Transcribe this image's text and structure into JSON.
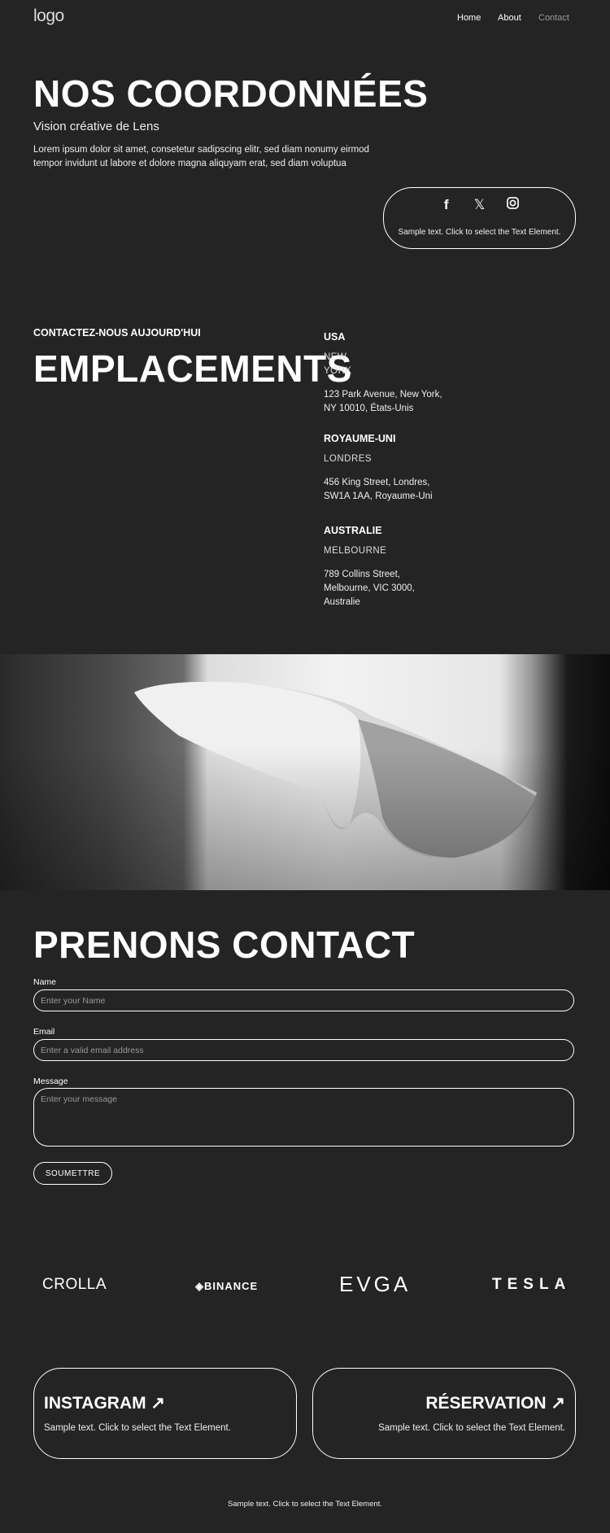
{
  "header": {
    "logo": "logo",
    "nav": [
      {
        "label": "Home"
      },
      {
        "label": "About"
      },
      {
        "label": "Contact"
      }
    ],
    "nav_active_color": "#9a9a9a"
  },
  "hero": {
    "title": "NOS COORDONNÉES",
    "subtitle": "Vision créative de Lens",
    "body": "Lorem ipsum dolor sit amet, consetetur sadipscing elitr, sed diam nonumy eirmod tempor invidunt ut labore et dolore magna aliquyam erat, sed diam voluptua",
    "social": {
      "icons": [
        "facebook-icon",
        "x-icon",
        "instagram-icon"
      ],
      "text": "Sample text. Click to select the Text Element."
    }
  },
  "locations": {
    "kicker": "CONTACTEZ-NOUS AUJOURD'HUI",
    "title": "EMPLACEMENTS",
    "items": [
      {
        "country": "USA",
        "city": "NEW YORK",
        "address": "123 Park Avenue, New York, NY 10010, États-Unis"
      },
      {
        "country": "ROYAUME-UNI",
        "city": "LONDRES",
        "address": "456 King Street, Londres, SW1A 1AA, Royaume-Uni"
      },
      {
        "country": "AUSTRALIE",
        "city": "MELBOURNE",
        "address": "789 Collins Street, Melbourne, VIC 3000, Australie"
      }
    ]
  },
  "contact": {
    "title": "PRENONS CONTACT",
    "name": {
      "label": "Name",
      "placeholder": "Enter your Name"
    },
    "email": {
      "label": "Email",
      "placeholder": "Enter a valid email address"
    },
    "message": {
      "label": "Message",
      "placeholder": "Enter your message"
    },
    "submit": "SOUMETTRE"
  },
  "brands": [
    "CROLLA",
    "BINANCE",
    "EVGA",
    "TESLA"
  ],
  "cards": [
    {
      "title": "INSTAGRAM ↗",
      "text": "Sample text. Click to select the Text Element."
    },
    {
      "title": "RÉSERVATION ↗",
      "text": "Sample text. Click to select the Text Element."
    }
  ],
  "footer": {
    "text": "Sample text. Click to select the Text Element."
  }
}
